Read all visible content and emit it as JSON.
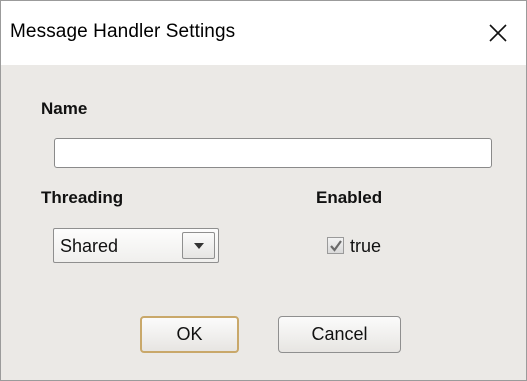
{
  "window": {
    "title": "Message Handler Settings"
  },
  "form": {
    "name_label": "Name",
    "name_value": "",
    "threading_label": "Threading",
    "threading_value": "Shared",
    "enabled_label": "Enabled",
    "enabled_checked": true,
    "enabled_value_label": "true"
  },
  "buttons": {
    "ok_label": "OK",
    "cancel_label": "Cancel"
  },
  "icons": {
    "close": "close-icon",
    "dropdown": "chevron-down-icon",
    "check": "checkmark-icon"
  },
  "colors": {
    "dialog_body": "#ebe9e6",
    "default_button_border": "#c9a86a"
  }
}
